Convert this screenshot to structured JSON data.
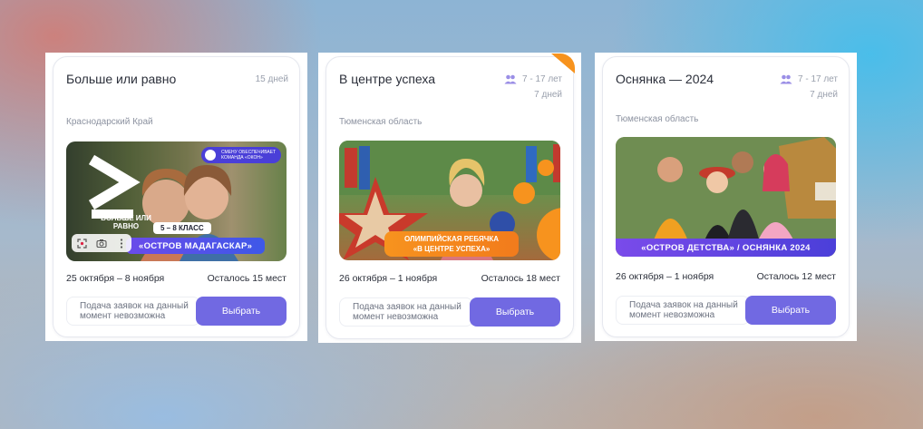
{
  "cards": [
    {
      "title": "Больше или равно",
      "age": "",
      "duration": "15 дней",
      "region": "Краснодарский Край",
      "banner": {
        "logo_text": "БОЛЬШЕ ИЛИ РАВНО",
        "badge_text": "СМЕНУ ОБЕСПЕЧИВАЕТ КОМАНДА «ОКОН»",
        "grade_pill": "5 – 8 КЛАСС",
        "ribbon": "«ОСТРОВ МАДАГАСКАР»"
      },
      "dates": "25 октября – 8 ноября",
      "places": "Осталось 15 мест",
      "note": "Подача заявок на данный момент невозможна",
      "button": "Выбрать"
    },
    {
      "title": "В центре успеха",
      "age": "7 - 17 лет",
      "duration": "7 дней",
      "region": "Тюменская область",
      "banner": {
        "ribbon_line1": "ОЛИМПИЙСКАЯ РЕБЯЧКА",
        "ribbon_line2": "«В ЦЕНТРЕ УСПЕХА»"
      },
      "dates": "26 октября – 1 ноября",
      "places": "Осталось 18 мест",
      "note": "Подача заявок на данный момент невозможна",
      "button": "Выбрать"
    },
    {
      "title": "Оснянка — 2024",
      "age": "7 - 17 лет",
      "duration": "7 дней",
      "region": "Тюменская область",
      "banner": {
        "ribbon": "«ОСТРОВ ДЕТСТВА» / ОСНЯНКА 2024"
      },
      "dates": "26 октября – 1 ноября",
      "places": "Осталось 12 мест",
      "note": "Подача заявок на данный момент невозможна",
      "button": "Выбрать"
    }
  ],
  "colors": {
    "accent": "#7169e2",
    "ribbon": "#5a4de8",
    "orange": "#f7931e"
  },
  "icons": [
    "people-icon",
    "scan-icon",
    "camera-icon",
    "more-vertical-icon"
  ]
}
